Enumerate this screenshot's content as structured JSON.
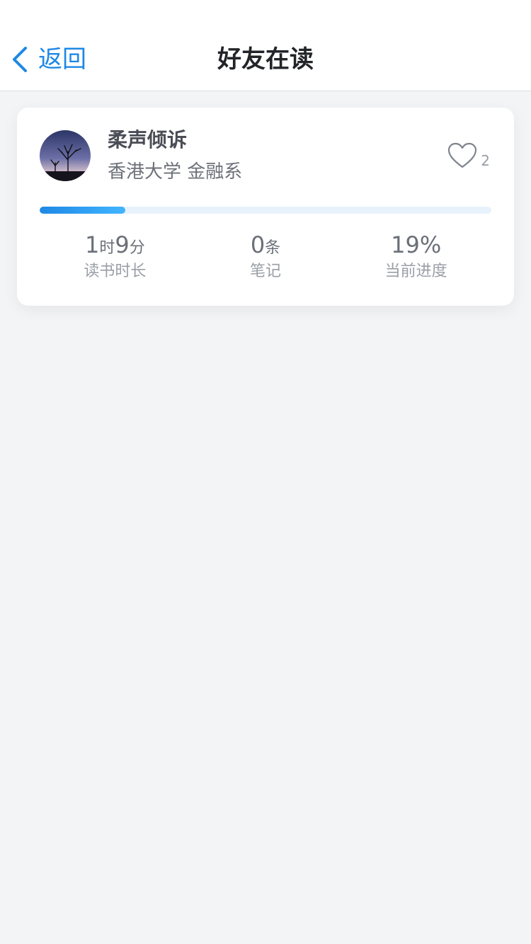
{
  "nav": {
    "back_label": "返回",
    "title": "好友在读"
  },
  "accent_color": "#1e88e5",
  "friend": {
    "name": "柔声倾诉",
    "school": "香港大学 金融系",
    "like_count": "2",
    "progress": 0.19,
    "stats": {
      "duration_hours": "1",
      "duration_hours_unit": "时",
      "duration_minutes": "9",
      "duration_minutes_unit": "分",
      "duration_label": "读书时长",
      "notes_value": "0",
      "notes_unit": "条",
      "notes_label": "笔记",
      "progress_value": "19%",
      "progress_label": "当前进度"
    }
  },
  "icons": {
    "back": "chevron-left-icon",
    "like": "heart-outline-icon",
    "avatar": "night-tree-avatar"
  }
}
